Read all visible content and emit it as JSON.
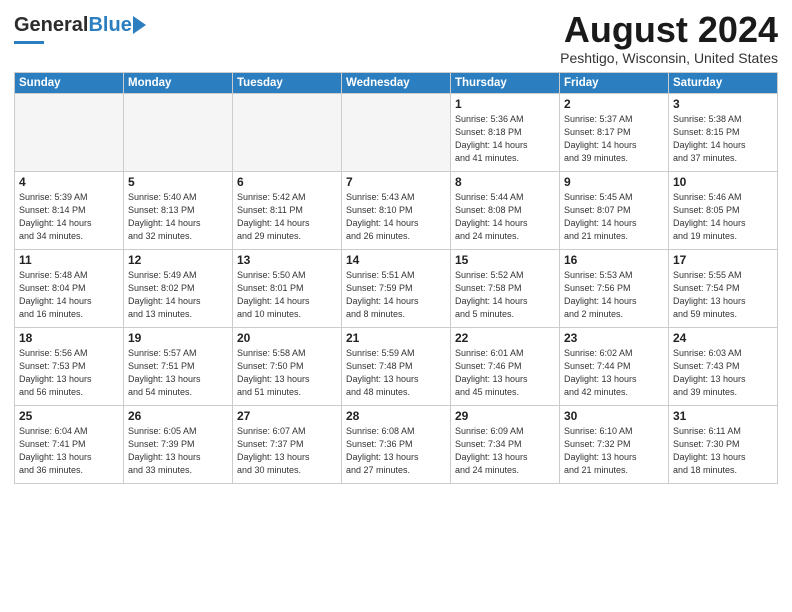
{
  "header": {
    "logo_general": "General",
    "logo_blue": "Blue",
    "month_title": "August 2024",
    "location": "Peshtigo, Wisconsin, United States"
  },
  "days_of_week": [
    "Sunday",
    "Monday",
    "Tuesday",
    "Wednesday",
    "Thursday",
    "Friday",
    "Saturday"
  ],
  "weeks": [
    [
      {
        "day": "",
        "empty": true
      },
      {
        "day": "",
        "empty": true
      },
      {
        "day": "",
        "empty": true
      },
      {
        "day": "",
        "empty": true
      },
      {
        "day": "1",
        "info": "Sunrise: 5:36 AM\nSunset: 8:18 PM\nDaylight: 14 hours\nand 41 minutes."
      },
      {
        "day": "2",
        "info": "Sunrise: 5:37 AM\nSunset: 8:17 PM\nDaylight: 14 hours\nand 39 minutes."
      },
      {
        "day": "3",
        "info": "Sunrise: 5:38 AM\nSunset: 8:15 PM\nDaylight: 14 hours\nand 37 minutes."
      }
    ],
    [
      {
        "day": "4",
        "info": "Sunrise: 5:39 AM\nSunset: 8:14 PM\nDaylight: 14 hours\nand 34 minutes."
      },
      {
        "day": "5",
        "info": "Sunrise: 5:40 AM\nSunset: 8:13 PM\nDaylight: 14 hours\nand 32 minutes."
      },
      {
        "day": "6",
        "info": "Sunrise: 5:42 AM\nSunset: 8:11 PM\nDaylight: 14 hours\nand 29 minutes."
      },
      {
        "day": "7",
        "info": "Sunrise: 5:43 AM\nSunset: 8:10 PM\nDaylight: 14 hours\nand 26 minutes."
      },
      {
        "day": "8",
        "info": "Sunrise: 5:44 AM\nSunset: 8:08 PM\nDaylight: 14 hours\nand 24 minutes."
      },
      {
        "day": "9",
        "info": "Sunrise: 5:45 AM\nSunset: 8:07 PM\nDaylight: 14 hours\nand 21 minutes."
      },
      {
        "day": "10",
        "info": "Sunrise: 5:46 AM\nSunset: 8:05 PM\nDaylight: 14 hours\nand 19 minutes."
      }
    ],
    [
      {
        "day": "11",
        "info": "Sunrise: 5:48 AM\nSunset: 8:04 PM\nDaylight: 14 hours\nand 16 minutes."
      },
      {
        "day": "12",
        "info": "Sunrise: 5:49 AM\nSunset: 8:02 PM\nDaylight: 14 hours\nand 13 minutes."
      },
      {
        "day": "13",
        "info": "Sunrise: 5:50 AM\nSunset: 8:01 PM\nDaylight: 14 hours\nand 10 minutes."
      },
      {
        "day": "14",
        "info": "Sunrise: 5:51 AM\nSunset: 7:59 PM\nDaylight: 14 hours\nand 8 minutes."
      },
      {
        "day": "15",
        "info": "Sunrise: 5:52 AM\nSunset: 7:58 PM\nDaylight: 14 hours\nand 5 minutes."
      },
      {
        "day": "16",
        "info": "Sunrise: 5:53 AM\nSunset: 7:56 PM\nDaylight: 14 hours\nand 2 minutes."
      },
      {
        "day": "17",
        "info": "Sunrise: 5:55 AM\nSunset: 7:54 PM\nDaylight: 13 hours\nand 59 minutes."
      }
    ],
    [
      {
        "day": "18",
        "info": "Sunrise: 5:56 AM\nSunset: 7:53 PM\nDaylight: 13 hours\nand 56 minutes."
      },
      {
        "day": "19",
        "info": "Sunrise: 5:57 AM\nSunset: 7:51 PM\nDaylight: 13 hours\nand 54 minutes."
      },
      {
        "day": "20",
        "info": "Sunrise: 5:58 AM\nSunset: 7:50 PM\nDaylight: 13 hours\nand 51 minutes."
      },
      {
        "day": "21",
        "info": "Sunrise: 5:59 AM\nSunset: 7:48 PM\nDaylight: 13 hours\nand 48 minutes."
      },
      {
        "day": "22",
        "info": "Sunrise: 6:01 AM\nSunset: 7:46 PM\nDaylight: 13 hours\nand 45 minutes."
      },
      {
        "day": "23",
        "info": "Sunrise: 6:02 AM\nSunset: 7:44 PM\nDaylight: 13 hours\nand 42 minutes."
      },
      {
        "day": "24",
        "info": "Sunrise: 6:03 AM\nSunset: 7:43 PM\nDaylight: 13 hours\nand 39 minutes."
      }
    ],
    [
      {
        "day": "25",
        "info": "Sunrise: 6:04 AM\nSunset: 7:41 PM\nDaylight: 13 hours\nand 36 minutes."
      },
      {
        "day": "26",
        "info": "Sunrise: 6:05 AM\nSunset: 7:39 PM\nDaylight: 13 hours\nand 33 minutes."
      },
      {
        "day": "27",
        "info": "Sunrise: 6:07 AM\nSunset: 7:37 PM\nDaylight: 13 hours\nand 30 minutes."
      },
      {
        "day": "28",
        "info": "Sunrise: 6:08 AM\nSunset: 7:36 PM\nDaylight: 13 hours\nand 27 minutes."
      },
      {
        "day": "29",
        "info": "Sunrise: 6:09 AM\nSunset: 7:34 PM\nDaylight: 13 hours\nand 24 minutes."
      },
      {
        "day": "30",
        "info": "Sunrise: 6:10 AM\nSunset: 7:32 PM\nDaylight: 13 hours\nand 21 minutes."
      },
      {
        "day": "31",
        "info": "Sunrise: 6:11 AM\nSunset: 7:30 PM\nDaylight: 13 hours\nand 18 minutes."
      }
    ]
  ]
}
